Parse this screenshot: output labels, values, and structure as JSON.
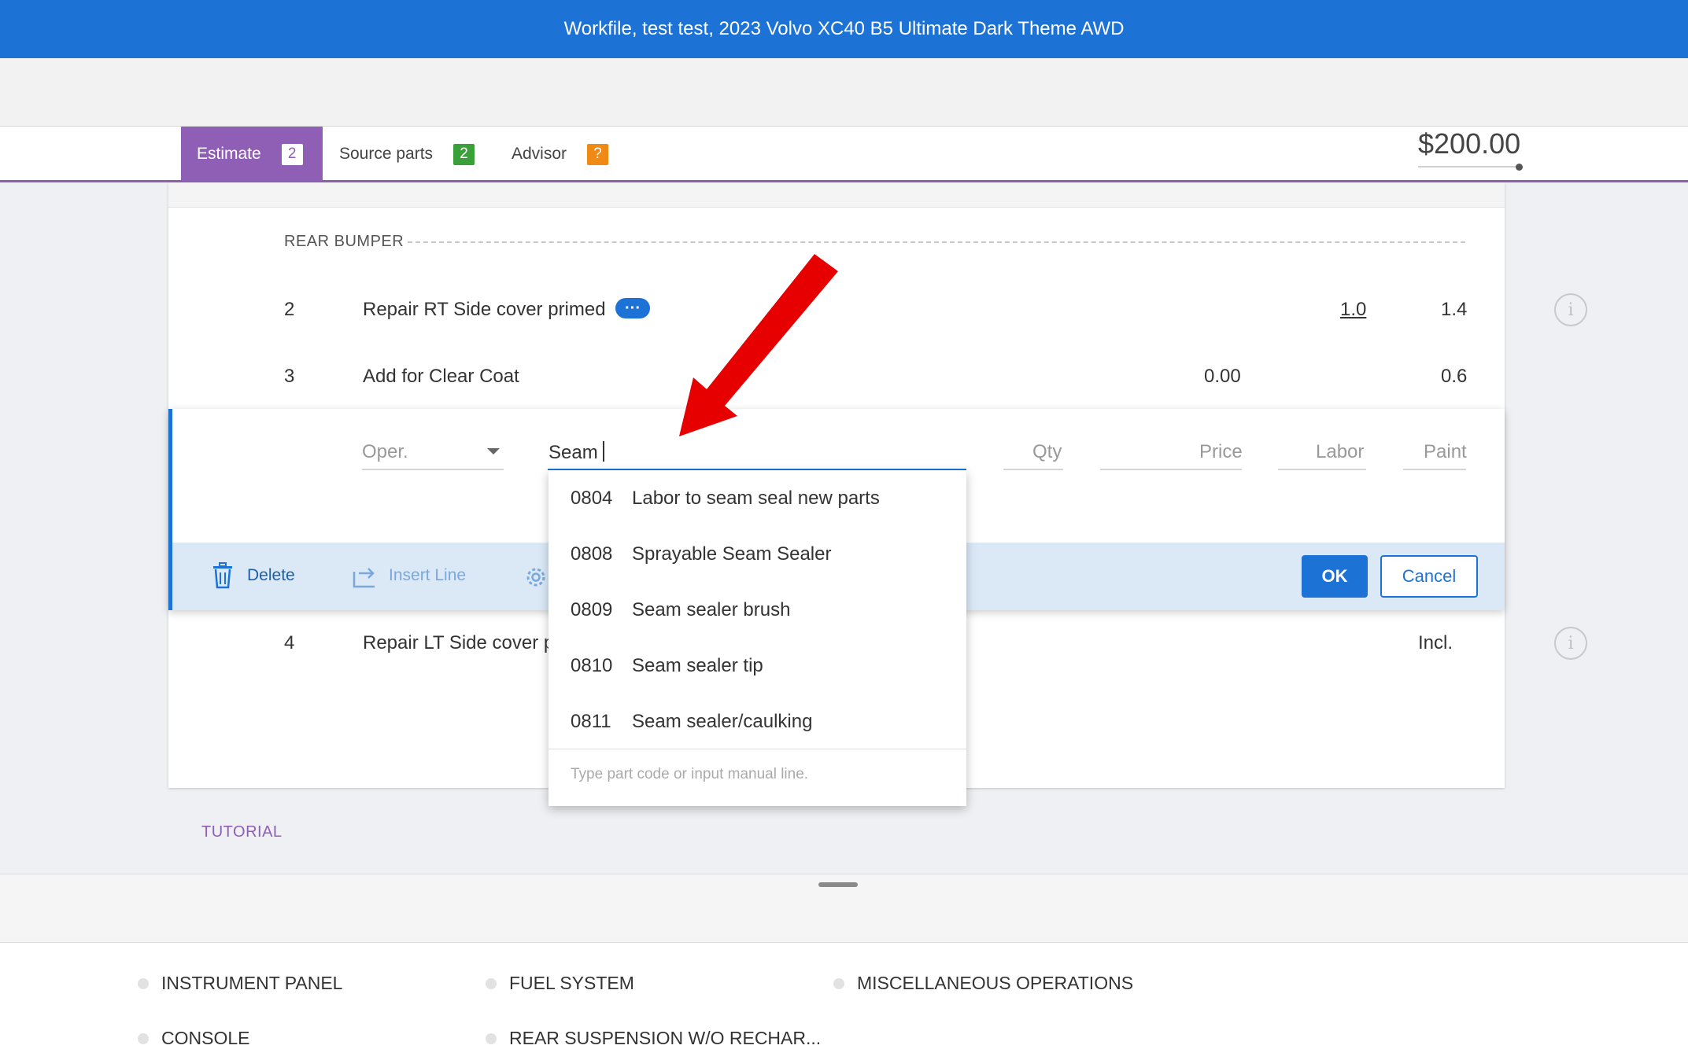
{
  "window": {
    "title": "Workfile, test test, 2023 Volvo XC40 B5 Ultimate Dark Theme AWD"
  },
  "tabs": [
    {
      "label": "Estimate",
      "badge": "2",
      "badge_color": "#ffffff",
      "active": true
    },
    {
      "label": "Source parts",
      "badge": "2",
      "badge_color": "#3aa03a"
    },
    {
      "label": "Advisor",
      "badge": "?",
      "badge_color": "#f08a14"
    }
  ],
  "total": "$200.00",
  "section": {
    "label": "REAR BUMPER"
  },
  "lines": [
    {
      "num": "2",
      "desc": "Repair RT Side cover primed",
      "labor": "1.0",
      "paint": "1.4"
    },
    {
      "num": "3",
      "desc": "Add for Clear Coat",
      "price": "0.00",
      "paint": "0.6"
    },
    {
      "num": "4",
      "desc": "Repair LT Side cover p",
      "paint": "Incl."
    }
  ],
  "editor": {
    "oper_placeholder": "Oper.",
    "search_value": "Seam",
    "qty_placeholder": "Qty",
    "price_placeholder": "Price",
    "labor_placeholder": "Labor",
    "paint_placeholder": "Paint",
    "delete_label": "Delete",
    "insert_label": "Insert Line",
    "ok_label": "OK",
    "cancel_label": "Cancel"
  },
  "dropdown": {
    "items": [
      {
        "code": "0804",
        "label": "Labor to seam seal new parts"
      },
      {
        "code": "0808",
        "label": "Sprayable Seam Sealer"
      },
      {
        "code": "0809",
        "label": "Seam sealer brush"
      },
      {
        "code": "0810",
        "label": "Seam sealer tip"
      },
      {
        "code": "0811",
        "label": "Seam sealer/caulking"
      }
    ],
    "hint": "Type part code or input manual line."
  },
  "tutorial_label": "TUTORIAL",
  "categories": [
    "INSTRUMENT PANEL",
    "FUEL SYSTEM",
    "MISCELLANEOUS OPERATIONS",
    "CONSOLE",
    "REAR SUSPENSION W/O RECHAR..."
  ],
  "colors": {
    "primary": "#1d72d6",
    "tab_active": "#8e5fb5",
    "annotation_arrow": "#e60000"
  }
}
